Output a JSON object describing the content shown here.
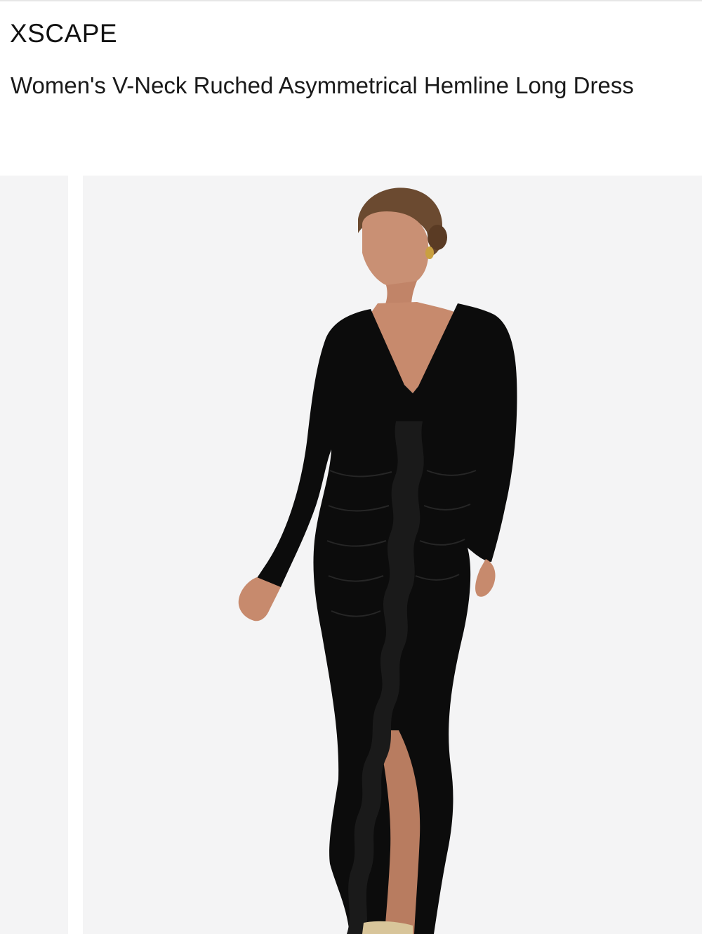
{
  "product": {
    "brand": "XSCAPE",
    "title": "Women's V-Neck Ruched Asymmetrical Hemline Long Dress"
  },
  "gallery": {
    "background_color": "#f4f4f5",
    "dress_color": "#0c0c0c"
  }
}
